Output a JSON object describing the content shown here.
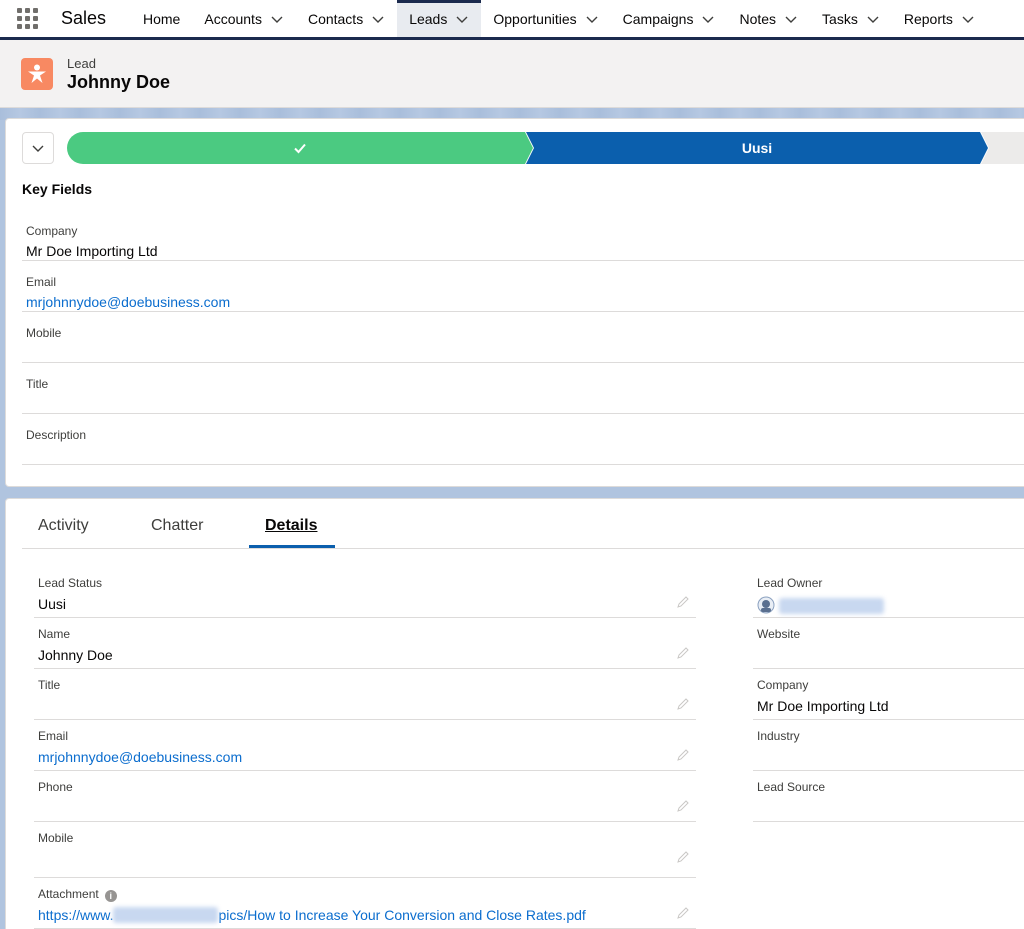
{
  "app": {
    "name": "Sales"
  },
  "nav": {
    "items": [
      {
        "label": "Home",
        "has_menu": false
      },
      {
        "label": "Accounts",
        "has_menu": true
      },
      {
        "label": "Contacts",
        "has_menu": true
      },
      {
        "label": "Leads",
        "has_menu": true,
        "active": true
      },
      {
        "label": "Opportunities",
        "has_menu": true
      },
      {
        "label": "Campaigns",
        "has_menu": true
      },
      {
        "label": "Notes",
        "has_menu": true
      },
      {
        "label": "Tasks",
        "has_menu": true
      },
      {
        "label": "Reports",
        "has_menu": true
      }
    ]
  },
  "header": {
    "object_type": "Lead",
    "record_name": "Johnny Doe",
    "icon": "lead-icon"
  },
  "path": {
    "completed_stage_icon": "checkmark-icon",
    "current_stage": "Uusi"
  },
  "key_fields": {
    "title": "Key Fields",
    "fields": [
      {
        "label": "Company",
        "value": "Mr Doe Importing Ltd"
      },
      {
        "label": "Email",
        "value": "mrjohnnydoe@doebusiness.com",
        "link": true
      },
      {
        "label": "Mobile",
        "value": ""
      },
      {
        "label": "Title",
        "value": ""
      },
      {
        "label": "Description",
        "value": ""
      }
    ]
  },
  "tabs": [
    {
      "label": "Activity"
    },
    {
      "label": "Chatter"
    },
    {
      "label": "Details",
      "selected": true
    }
  ],
  "details": {
    "left": [
      {
        "label": "Lead Status",
        "value": "Uusi"
      },
      {
        "label": "Name",
        "value": "Johnny Doe"
      },
      {
        "label": "Title",
        "value": ""
      },
      {
        "label": "Email",
        "value": "mrjohnnydoe@doebusiness.com",
        "link": true
      },
      {
        "label": "Phone",
        "value": ""
      },
      {
        "label": "Mobile",
        "value": ""
      },
      {
        "label": "Attachment",
        "value_prefix": "https://www.",
        "value_suffix": "pics/How to Increase Your Conversion and Close Rates.pdf",
        "link": true
      }
    ],
    "right": [
      {
        "label": "Lead Owner",
        "value": ""
      },
      {
        "label": "Website",
        "value": ""
      },
      {
        "label": "Company",
        "value": "Mr Doe Importing Ltd"
      },
      {
        "label": "Industry",
        "value": ""
      },
      {
        "label": "Lead Source",
        "value": ""
      }
    ]
  },
  "colors": {
    "nav_accent": "#1b2a4e",
    "lead_icon": "#f88962",
    "path_complete": "#4bca81",
    "path_current": "#0b5fad",
    "link": "#0b6dce"
  }
}
